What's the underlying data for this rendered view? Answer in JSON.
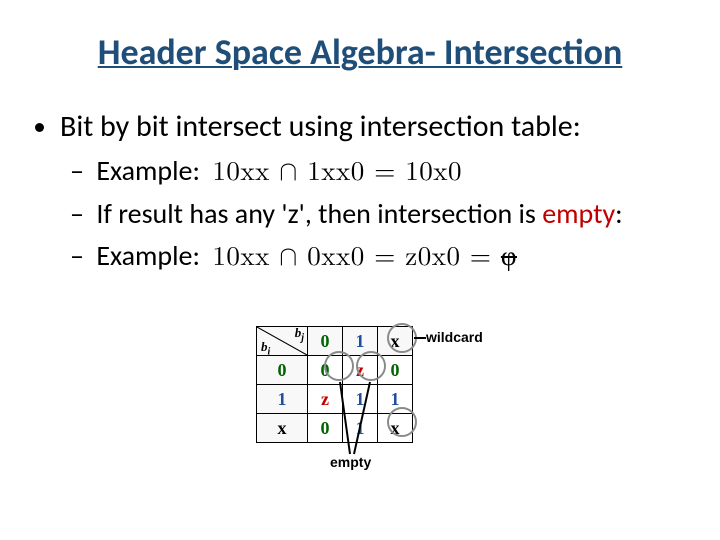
{
  "title": "Header Space Algebra- Intersection",
  "bullets": {
    "main": "Bit by bit intersect using intersection table:",
    "sub1_label": "Example:",
    "sub1_math": "10xx ∩ 1xx0 = 10x0",
    "sub2_before": "If result has any 'z', then intersection is ",
    "sub2_empty": "empty",
    "sub2_after": ":",
    "sub3_label": "Example:",
    "sub3_math_a": "10xx ∩ 0xx0 = z0x0 = ",
    "sub3_math_phi": "φ"
  },
  "table": {
    "row_axis": "b",
    "row_axis_sub": "i",
    "col_axis": "b",
    "col_axis_sub": "j",
    "col_headers": [
      "0",
      "1",
      "x"
    ],
    "row_headers": [
      "0",
      "1",
      "x"
    ],
    "cells": [
      [
        "0",
        "z",
        "0"
      ],
      [
        "z",
        "1",
        "1"
      ],
      [
        "0",
        "1",
        "x"
      ]
    ]
  },
  "annotations": {
    "wildcard": "wildcard",
    "empty": "empty"
  }
}
